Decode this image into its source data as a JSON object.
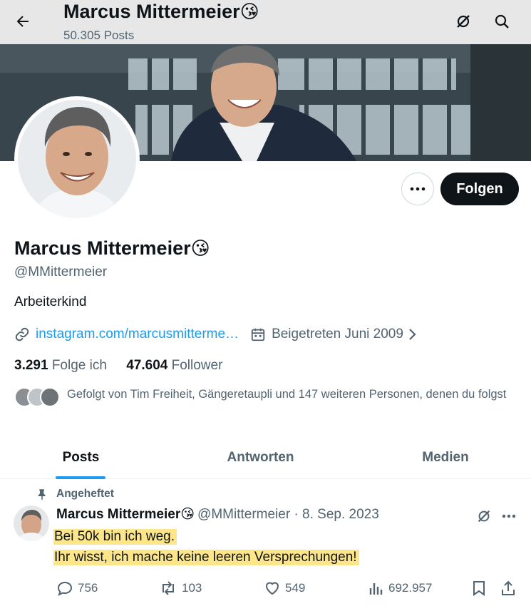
{
  "header": {
    "title": "Marcus Mittermeier",
    "post_count": "50.305 Posts"
  },
  "profile": {
    "name": "Marcus Mittermeier",
    "emoji": "😘",
    "handle": "@MMittermeier",
    "bio": "Arbeiterkind",
    "link": "instagram.com/marcusmitterme…",
    "joined": "Beigetreten Juni 2009",
    "following_count": "3.291",
    "following_label": "Folge ich",
    "followers_count": "47.604",
    "followers_label": "Follower",
    "followed_by": "Gefolgt von Tim Freiheit, Gängeretaupli und 147 weiteren Personen, denen du folgst"
  },
  "buttons": {
    "follow": "Folgen"
  },
  "tabs": [
    {
      "label": "Posts",
      "active": true
    },
    {
      "label": "Antworten",
      "active": false
    },
    {
      "label": "Medien",
      "active": false
    }
  ],
  "post": {
    "pinned_label": "Angeheftet",
    "author": "Marcus Mittermeier",
    "emoji": "😘",
    "handle_date": "@MMittermeier · 8. Sep. 2023",
    "line1": "Bei 50k bin ich weg.",
    "line2": "Ihr wisst, ich mache keine leeren Versprechungen!",
    "replies": "756",
    "reposts": "103",
    "likes": "549",
    "views": "692.957"
  },
  "colors": {
    "accent": "#1d9bf0",
    "highlight": "#fde68a",
    "follow_button": "#0f1419"
  },
  "icons": [
    "back-arrow-icon",
    "grok-icon",
    "search-icon",
    "more-icon",
    "link-icon",
    "calendar-icon",
    "chevron-right-icon",
    "pin-icon",
    "reply-icon",
    "repost-icon",
    "like-icon",
    "views-icon",
    "bookmark-icon",
    "share-icon"
  ]
}
